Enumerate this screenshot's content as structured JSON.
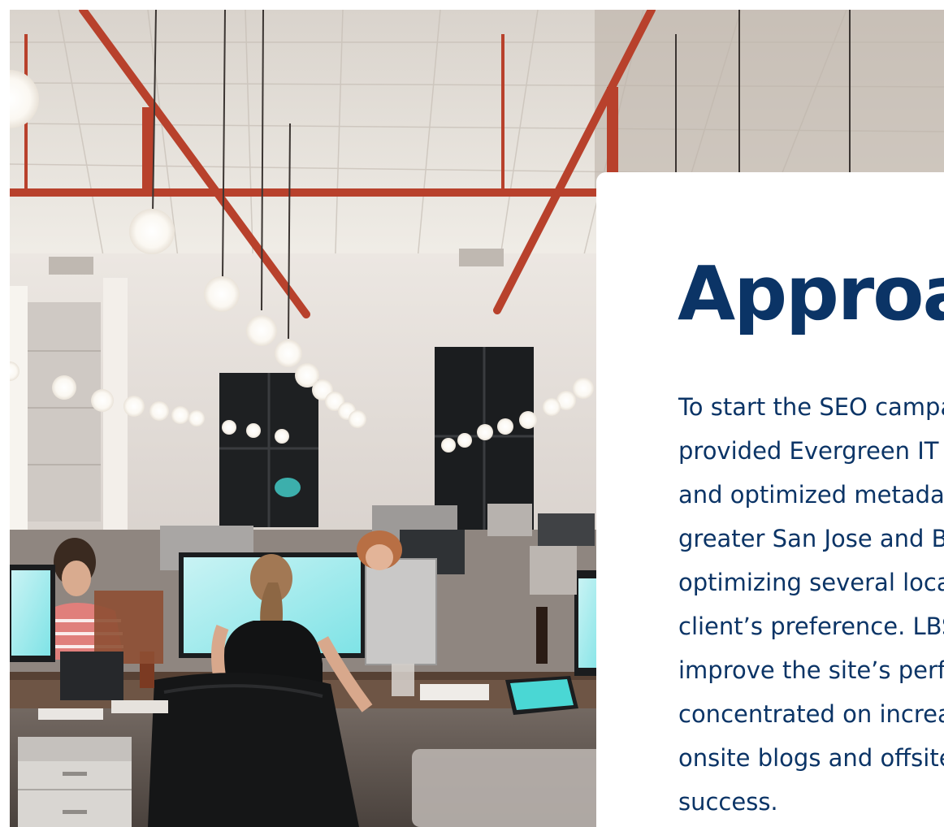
{
  "section": {
    "image_alt": "Open-plan office with people working at computer desks under hanging light bulbs",
    "title": "Approach",
    "body_lines": [
      "To start the SEO campaign, LBS",
      "provided Evergreen IT with new",
      "and optimized metadata for the",
      "greater San Jose and Bay Area,",
      "optimizing several local pages per",
      "client’s preference. LBS worked to",
      "improve the site’s performance and",
      "concentrated on increasing both",
      "onsite blogs and offsite content for",
      "success."
    ]
  },
  "colors": {
    "heading": "#0b3466",
    "body_text": "#0b3466",
    "card_background": "#ffffff",
    "ceiling_pipes": "#b8412c"
  }
}
